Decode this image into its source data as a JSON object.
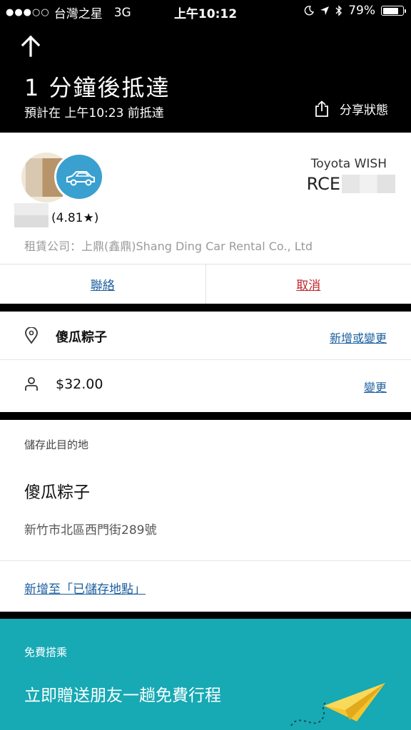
{
  "status_bar": {
    "carrier": "台灣之星",
    "signal_dots": "●●●○○",
    "network": "3G",
    "time": "上午10:12",
    "battery_percent": "79%",
    "battery_level": 0.79,
    "icons": [
      "moon-icon",
      "location-arrow-icon",
      "bluetooth-icon",
      "battery-icon"
    ]
  },
  "header": {
    "back_icon": "up-arrow-icon",
    "eta_title": "1 分鐘後抵達",
    "eta_subtitle": "預計在 上午10:23 前抵達",
    "share_label": "分享狀態",
    "share_icon": "share-icon"
  },
  "driver": {
    "rating": "(4.81★)",
    "company": "租賃公司：上鼎(鑫鼎)Shang Ding Car Rental Co., Ltd",
    "car_model": "Toyota WISH",
    "plate_prefix": "RCE",
    "car_icon": "car-icon"
  },
  "actions": {
    "contact_label": "聯絡",
    "cancel_label": "取消"
  },
  "trip": {
    "destination": "傻瓜粽子",
    "destination_link": "新增或變更",
    "destination_icon": "location-pin-icon",
    "fare": "$32.00",
    "fare_link": "變更",
    "fare_icon": "person-icon"
  },
  "save_destination": {
    "label": "儲存此目的地",
    "place_name": "傻瓜粽子",
    "address": "新竹市北區西門街289號",
    "add_link": "新增至「已儲存地點」"
  },
  "promo": {
    "label": "免費搭乘",
    "title": "立即贈送朋友一趟免費行程",
    "icon": "paper-plane-icon"
  },
  "colors": {
    "link_blue": "#1b5f9e",
    "cancel_red": "#c0262d",
    "car_badge": "#3aa0cf",
    "promo_teal": "#17a9b4"
  }
}
